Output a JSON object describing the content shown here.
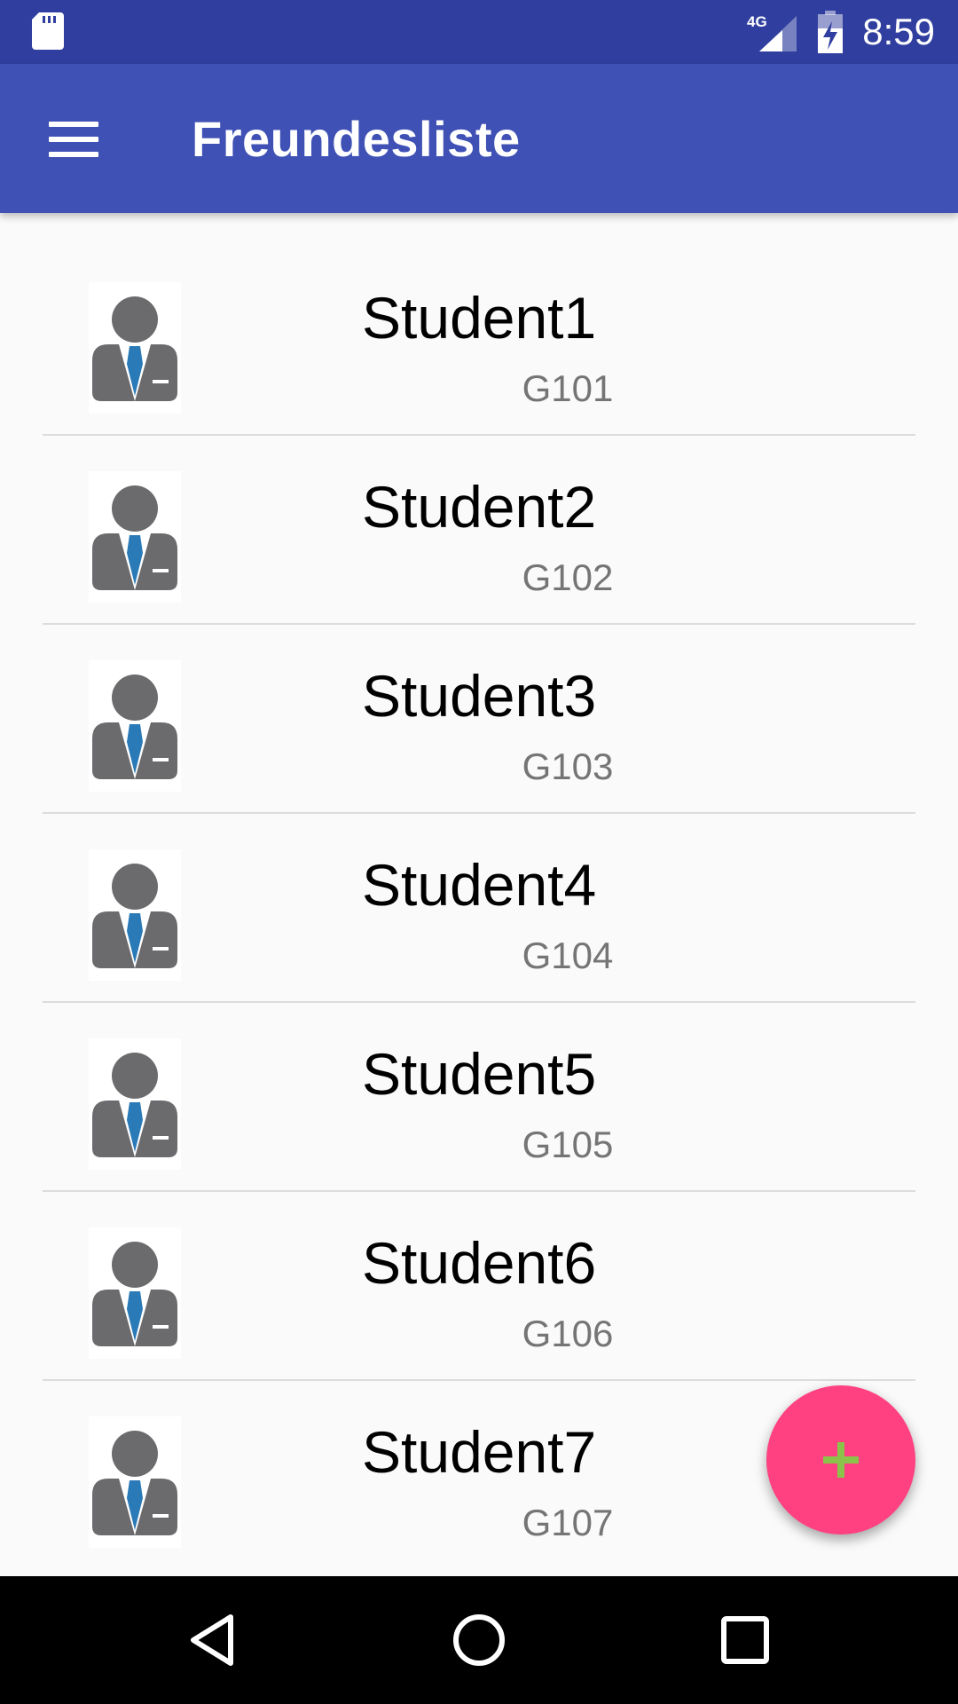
{
  "status_bar": {
    "network": "4G",
    "time": "8:59"
  },
  "app_bar": {
    "title": "Freundesliste"
  },
  "students": [
    {
      "name": "Student1",
      "group": "G101"
    },
    {
      "name": "Student2",
      "group": "G102"
    },
    {
      "name": "Student3",
      "group": "G103"
    },
    {
      "name": "Student4",
      "group": "G104"
    },
    {
      "name": "Student5",
      "group": "G105"
    },
    {
      "name": "Student6",
      "group": "G106"
    },
    {
      "name": "Student7",
      "group": "G107"
    }
  ],
  "icons": {
    "menu": "menu-icon",
    "avatar": "businessman-avatar-icon",
    "fab": "add-icon",
    "nav_back": "back-icon",
    "nav_home": "home-icon",
    "nav_recent": "recent-apps-icon"
  },
  "colors": {
    "status_bar": "#303f9f",
    "app_bar": "#3f51b5",
    "fab": "#ff4081",
    "fab_icon": "#8bc34a",
    "avatar_body": "#6b6b6e",
    "avatar_tie": "#2a7ab8"
  }
}
